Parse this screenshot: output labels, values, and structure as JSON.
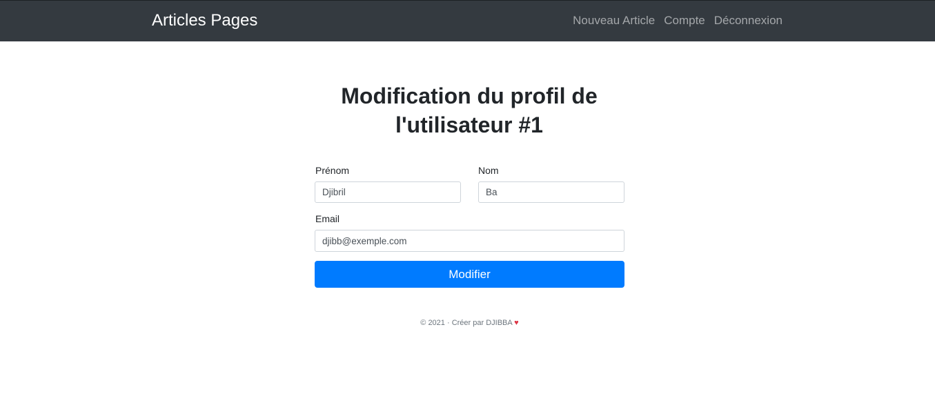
{
  "navbar": {
    "brand": "Articles Pages",
    "links": [
      "Nouveau Article",
      "Compte",
      "Déconnexion"
    ]
  },
  "page": {
    "title_line1": "Modification du profil de",
    "title_line2": "l'utilisateur #1"
  },
  "form": {
    "prenom_label": "Prénom",
    "prenom_value": "Djibril",
    "nom_label": "Nom",
    "nom_value": "Ba",
    "email_label": "Email",
    "email_value": "djibb@exemple.com",
    "submit_label": "Modifier"
  },
  "footer": {
    "text": "© 2021 · Créer par DJIBBA",
    "heart": "♥"
  },
  "colors": {
    "navbar_bg": "#343a40",
    "primary": "#007bff",
    "heart": "#dc3545"
  }
}
